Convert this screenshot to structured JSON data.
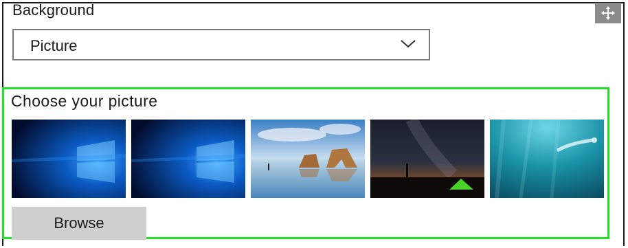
{
  "background": {
    "title": "Background",
    "dropdown_value": "Picture"
  },
  "picture_chooser": {
    "label": "Choose your picture",
    "thumbnails": [
      {
        "icon": "windows-hero-wallpaper"
      },
      {
        "icon": "windows-hero-wallpaper"
      },
      {
        "icon": "beach-rocks-wallpaper"
      },
      {
        "icon": "night-sky-tent-wallpaper"
      },
      {
        "icon": "underwater-swimmer-wallpaper"
      }
    ],
    "browse_label": "Browse",
    "highlight_color": "#22e02a"
  }
}
